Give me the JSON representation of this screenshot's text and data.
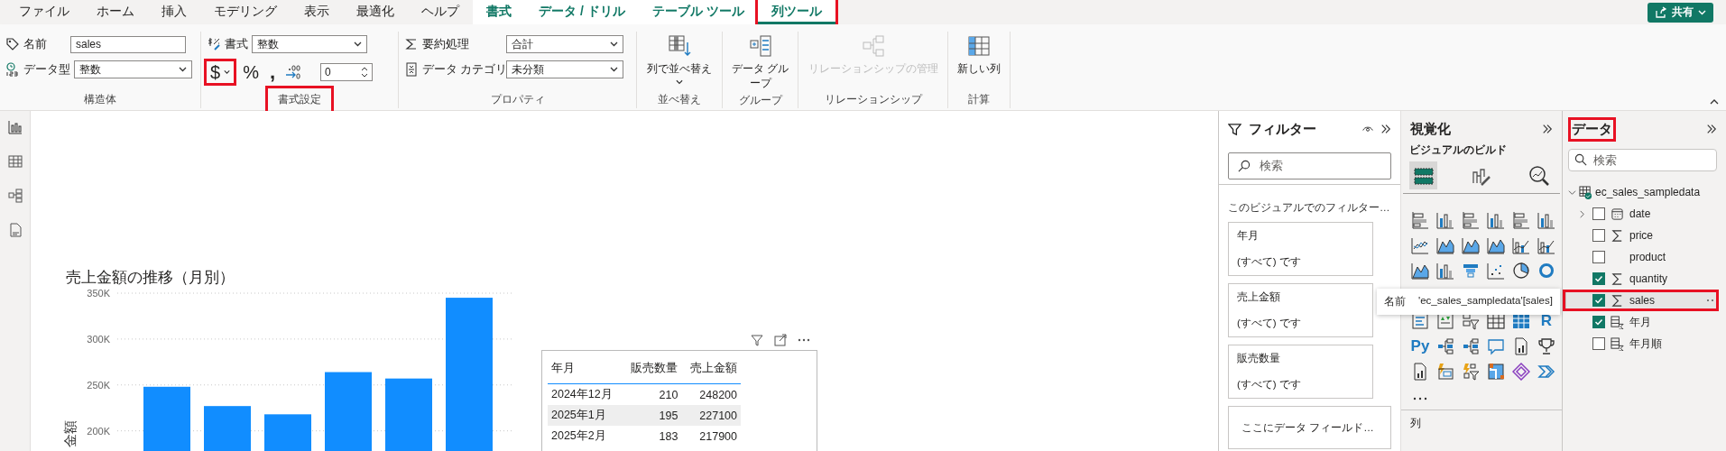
{
  "tabs": [
    {
      "label": "ファイル",
      "kind": "standard",
      "selected": false,
      "highlighted": false
    },
    {
      "label": "ホーム",
      "kind": "standard",
      "selected": false,
      "highlighted": false
    },
    {
      "label": "挿入",
      "kind": "standard",
      "selected": false,
      "highlighted": false
    },
    {
      "label": "モデリング",
      "kind": "standard",
      "selected": false,
      "highlighted": false
    },
    {
      "label": "表示",
      "kind": "standard",
      "selected": false,
      "highlighted": false
    },
    {
      "label": "最適化",
      "kind": "standard",
      "selected": false,
      "highlighted": false
    },
    {
      "label": "ヘルプ",
      "kind": "standard",
      "selected": false,
      "highlighted": false
    },
    {
      "label": "書式",
      "kind": "contextual",
      "selected": false,
      "highlighted": false
    },
    {
      "label": "データ / ドリル",
      "kind": "contextual",
      "selected": false,
      "highlighted": false
    },
    {
      "label": "テーブル ツール",
      "kind": "contextual",
      "selected": false,
      "highlighted": false
    },
    {
      "label": "列ツール",
      "kind": "contextual",
      "selected": true,
      "highlighted": true
    }
  ],
  "share_button": {
    "label": "共有"
  },
  "ribbon": {
    "structure": {
      "label": "構造体",
      "name_label": "名前",
      "name_value": "sales",
      "type_label": "データ型",
      "type_value": "整数"
    },
    "formatting": {
      "label": "書式設定",
      "label_highlighted": true,
      "format_label": "書式",
      "format_value": "整数",
      "currency_symbol": "$",
      "currency_highlighted": true,
      "percent_symbol": "%",
      "comma_symbol": ",",
      "decimals": "0"
    },
    "properties": {
      "label": "プロパティ",
      "summarize_label": "要約処理",
      "summarize_value": "合計",
      "category_label": "データ カテゴリ",
      "category_value": "未分類"
    },
    "sort": {
      "label": "並べ替え",
      "button": "列で並べ替え"
    },
    "grouping": {
      "label": "グループ",
      "button": "データ グループ"
    },
    "relationships": {
      "label": "リレーションシップ",
      "button": "リレーションシップの管理",
      "disabled": true
    },
    "calculations": {
      "label": "計算",
      "button": "新しい列"
    }
  },
  "chart": {
    "title": "売上金額の推移（月別）",
    "chart_data": {
      "type": "bar",
      "ylabel": "金額",
      "ylim": [
        180000,
        350000
      ],
      "yticks": [
        {
          "value": 200000,
          "label": "200K"
        },
        {
          "value": 250000,
          "label": "250K"
        },
        {
          "value": 300000,
          "label": "300K"
        },
        {
          "value": 350000,
          "label": "350K"
        }
      ],
      "grid": true,
      "values": [
        248000,
        227000,
        218000,
        264000,
        257000,
        345000
      ]
    }
  },
  "table_visual": {
    "columns": [
      "年月",
      "販売数量",
      "売上金額"
    ],
    "rows": [
      [
        "2024年12月",
        "210",
        "248200"
      ],
      [
        "2025年1月",
        "195",
        "227100"
      ],
      [
        "2025年2月",
        "183",
        "217900"
      ]
    ]
  },
  "filter_pane": {
    "title": "フィルター",
    "search_placeholder": "検索",
    "section": "このビジュアルでのフィルター…",
    "cards": [
      {
        "title": "年月",
        "value": "(すべて) です"
      },
      {
        "title": "売上金額",
        "value": "(すべて) です"
      },
      {
        "title": "販売数量",
        "value": "(すべて) です"
      }
    ],
    "add_field": "ここにデータ フィールド…"
  },
  "viz_pane": {
    "title": "視覚化",
    "subtitle": "ビジュアルのビルド",
    "modes": [
      {
        "selected": true
      },
      {
        "selected": false
      },
      {
        "selected": false
      }
    ],
    "script_labels": [
      "R",
      "Py"
    ],
    "well_label": "列"
  },
  "tooltip": {
    "label": "名前",
    "value": "'ec_sales_sampledata'[sales]"
  },
  "data_pane": {
    "title": "データ",
    "title_highlighted": true,
    "search_placeholder": "検索",
    "table": {
      "name": "ec_sales_sampledata",
      "expanded": true,
      "fields": [
        {
          "label": "date",
          "kind": "date",
          "checked": false,
          "selected": false,
          "highlighted": false
        },
        {
          "label": "price",
          "kind": "sum",
          "checked": false,
          "selected": false,
          "highlighted": false
        },
        {
          "label": "product",
          "kind": "text",
          "checked": false,
          "selected": false,
          "highlighted": false
        },
        {
          "label": "quantity",
          "kind": "sum",
          "checked": true,
          "selected": false,
          "highlighted": false
        },
        {
          "label": "sales",
          "kind": "sum",
          "checked": true,
          "selected": true,
          "highlighted": true
        },
        {
          "label": "年月",
          "kind": "calc",
          "checked": true,
          "selected": false,
          "highlighted": false
        },
        {
          "label": "年月順",
          "kind": "calc",
          "checked": false,
          "selected": false,
          "highlighted": false
        }
      ]
    }
  }
}
